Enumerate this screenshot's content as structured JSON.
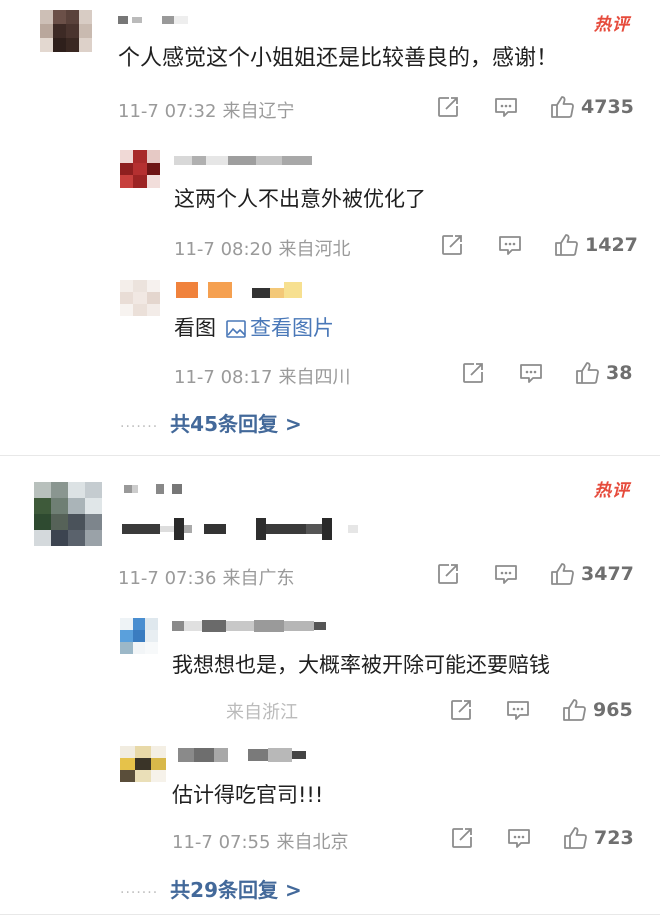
{
  "icons": {
    "share": "share-icon",
    "comment": "comment-icon",
    "like": "thumbs-up-icon",
    "image": "image-icon"
  },
  "colors": {
    "hot_badge": "#e64b3c",
    "link": "#43699a",
    "meta": "#9a9a9a"
  },
  "comments": [
    {
      "badge": "热评",
      "text": "个人感觉这个小姐姐还是比较善良的，感谢！",
      "date": "11-7 07:32",
      "location": "来自辽宁",
      "likes": "4735",
      "replies": [
        {
          "text": "这两个人不出意外被优化了",
          "date": "11-7 08:20",
          "location": "来自河北",
          "likes": "1427"
        },
        {
          "text": "看图",
          "link_text": "查看图片",
          "date": "11-7 08:17",
          "location": "来自四川",
          "likes": "38"
        }
      ],
      "more": "共45条回复 >"
    },
    {
      "badge": "热评",
      "date": "11-7 07:36",
      "location": "来自广东",
      "likes": "3477",
      "replies": [
        {
          "text": "我想想也是，大概率被开除可能还要赔钱",
          "date": "",
          "location": "来自浙江",
          "likes": "965"
        },
        {
          "text": "估计得吃官司!!!",
          "date": "11-7 07:55",
          "location": "来自北京",
          "likes": "723"
        }
      ],
      "more": "共29条回复 >"
    }
  ]
}
